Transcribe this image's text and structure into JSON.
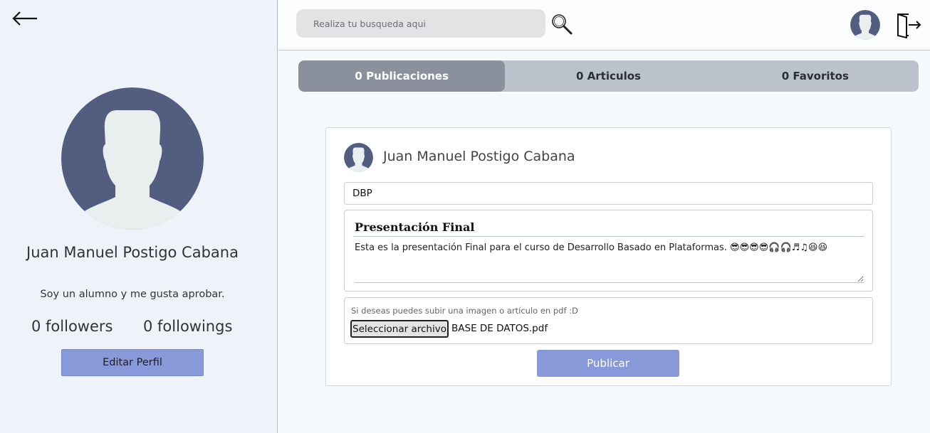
{
  "sidebar": {
    "profile": {
      "name": "Juan Manuel Postigo Cabana",
      "bio": "Soy un alumno y me gusta aprobar.",
      "followers": "0 followers",
      "followings": "0 followings"
    },
    "edit_button_label": "Editar Perfil"
  },
  "header": {
    "search_placeholder": "Realiza tu busqueda aqui"
  },
  "tabs": [
    {
      "label": "0 Publicaciones",
      "active": true
    },
    {
      "label": "0 Articulos",
      "active": false
    },
    {
      "label": "0 Favoritos",
      "active": false
    }
  ],
  "post_form": {
    "author": "Juan Manuel Postigo Cabana",
    "title_value": "DBP",
    "editor_heading": "Presentación Final",
    "editor_body": "Esta es la presentación Final para el curso de Desarrollo Basado en Plataformas. 😎😎😎😎🎧🎧♬♫😆😆",
    "upload_hint": "Si deseas puedes subir una imagen o artículo en pdf :D",
    "file_button_label": "Seleccionar archivo",
    "file_name": "BASE DE DATOS.pdf",
    "publish_label": "Publicar"
  },
  "colors": {
    "accent": "#8799d8",
    "avatar_bg": "#525d80",
    "avatar_fg": "#e9eeee",
    "tab_active": "#8b919c",
    "tab_bg": "#bcc2cb"
  },
  "icons": [
    "arrow-left-icon",
    "search-icon",
    "user-avatar-icon",
    "logout-icon"
  ]
}
